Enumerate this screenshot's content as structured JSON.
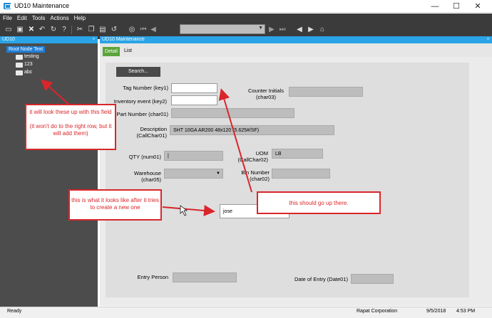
{
  "window": {
    "title": "UD10 Maintenance",
    "minimize_glyph": "—",
    "maximize_glyph": "☐",
    "close_glyph": "✕"
  },
  "menu": [
    "File",
    "Edit",
    "Tools",
    "Actions",
    "Help"
  ],
  "toolbar_icons": [
    "new-icon",
    "save-icon",
    "delete-icon",
    "undo-icon",
    "refresh-icon",
    "help-icon",
    "cut-icon",
    "copy-icon",
    "paste-icon",
    "undo-arrow-icon",
    "binoculars-icon",
    "first-record-icon",
    "prev-record-icon",
    "next-record-icon",
    "last-record-icon",
    "back-icon",
    "forward-icon",
    "home-icon"
  ],
  "tree": {
    "header": "UD10",
    "pin_glyph": "♆",
    "root": "Root Node Text",
    "nodes": [
      "testing",
      "123",
      "abc"
    ]
  },
  "form": {
    "header": "UD10 Maintenance",
    "pin_glyph": "♆",
    "tabs": {
      "detail": "Detail",
      "list": "List"
    },
    "search_button": "Search...",
    "labels": {
      "tag_number": "Tag Number (key1)",
      "inventory_event": "Inventory event (key2)",
      "part_number": "Part Number (char01)",
      "description": "Description\n(CallChar01)",
      "qty": "QTY (num01)",
      "warehouse": "Warehouse\n(char05)",
      "counter_initials": "Counter Initials\n(char03)",
      "uom": "UOM\n(CallChar02)",
      "bin_number": "Bin Number\n(char02)",
      "entry_person": "Entry Person",
      "date_of_entry": "Date of Entry (Date01)"
    },
    "values": {
      "tag_number": "",
      "inventory_event": "",
      "part_number": "",
      "description": "SHT 10GA AR200 48x120 (5.625#/SF)",
      "qty": "|",
      "warehouse": "",
      "counter_initials": "",
      "uom": "LB",
      "bin_number": "",
      "new_tag_box": "jose",
      "entry_person": "",
      "date_of_entry": ""
    }
  },
  "annotations": {
    "tree_note": "it will look these up with this field\n\n(it won't do to the right row, but it will add them)",
    "after_note": "this is what it looks like after it tries to create a new one",
    "should_note": "this should go up there."
  },
  "status": {
    "ready": "Ready",
    "company": "Rapat Corporation",
    "date": "9/5/2018",
    "time": "4:53 PM"
  },
  "colors": {
    "accent": "#2aa4e6",
    "tab_active": "#5ba43a",
    "annotation": "#d9262b",
    "chrome": "#3b3b3b"
  }
}
